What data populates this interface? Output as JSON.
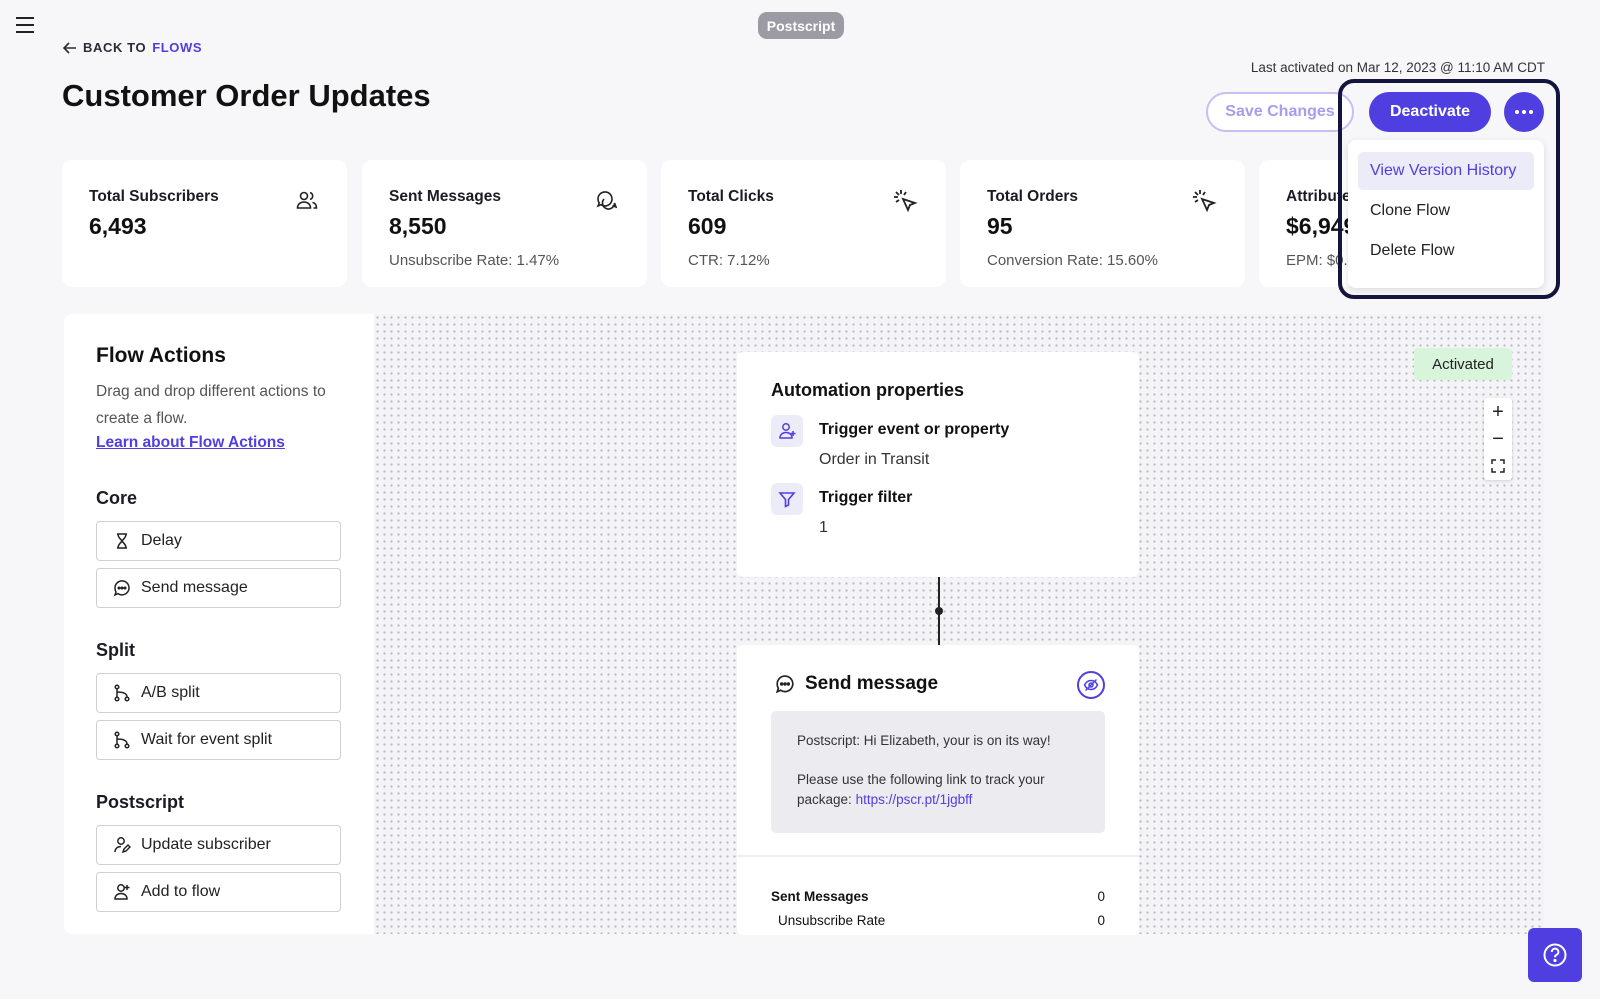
{
  "brand": {
    "name": "Postscript"
  },
  "nav": {
    "back_prefix": "BACK TO",
    "back_target": "FLOWS"
  },
  "page": {
    "title": "Customer Order Updates",
    "last_activated": "Last activated on Mar 12, 2023 @ 11:10 AM CDT"
  },
  "actions": {
    "save_label": "Save Changes",
    "deactivate_label": "Deactivate"
  },
  "stats": [
    {
      "label": "Total Subscribers",
      "value": "6,493",
      "sub": "",
      "icon": "users-icon"
    },
    {
      "label": "Sent Messages",
      "value": "8,550",
      "sub": "Unsubscribe Rate: 1.47%",
      "icon": "chat-bubbles-icon"
    },
    {
      "label": "Total Clicks",
      "value": "609",
      "sub": "CTR: 7.12%",
      "icon": "cursor-click-icon"
    },
    {
      "label": "Total Orders",
      "value": "95",
      "sub": "Conversion Rate: 15.60%",
      "icon": "cursor-click-icon"
    },
    {
      "label": "Attribute",
      "value": "$6,949",
      "sub": "EPM: $0.8",
      "icon": ""
    }
  ],
  "dropdown": {
    "items": [
      "View Version History",
      "Clone Flow",
      "Delete Flow"
    ]
  },
  "flow_actions": {
    "title": "Flow Actions",
    "description": "Drag and drop different actions to create a flow.",
    "link": "Learn about Flow Actions",
    "sections": [
      {
        "title": "Core",
        "items": [
          "Delay",
          "Send message"
        ]
      },
      {
        "title": "Split",
        "items": [
          "A/B split",
          "Wait for event split"
        ]
      },
      {
        "title": "Postscript",
        "items": [
          "Update subscriber",
          "Add to flow"
        ]
      }
    ]
  },
  "automation": {
    "title": "Automation properties",
    "trigger_label": "Trigger event or property",
    "trigger_value": "Order in Transit",
    "filter_label": "Trigger filter",
    "filter_value": "1"
  },
  "send_message": {
    "title": "Send message",
    "line1": "Postscript: Hi Elizabeth, your is on its way!",
    "line2": "Please use the following link to track your package:",
    "link": "https://pscr.pt/1jgbff",
    "stats": [
      {
        "label": "Sent Messages",
        "value": "0"
      },
      {
        "label": "Unsubscribe Rate",
        "value": "0"
      }
    ]
  },
  "canvas": {
    "status": "Activated",
    "zoom_in": "+",
    "zoom_out": "−"
  },
  "colors": {
    "accent": "#4f3fe0",
    "activated_bg": "#d8f4da"
  }
}
